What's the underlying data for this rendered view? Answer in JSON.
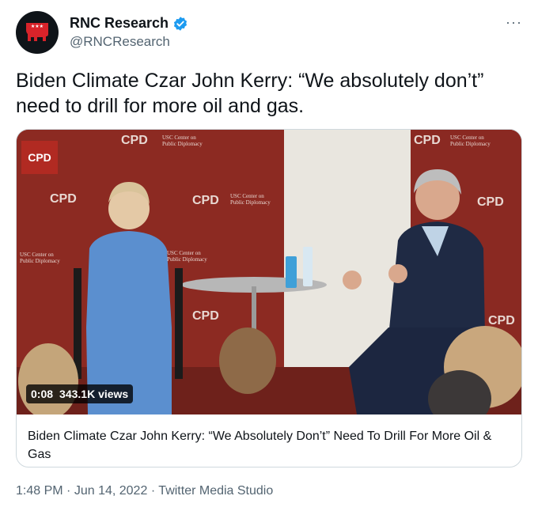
{
  "account": {
    "name": "RNC Research",
    "handle": "@RNCResearch",
    "more_icon": "more-horizontal-icon",
    "verified_icon": "verified-badge-icon"
  },
  "tweet": {
    "text": "Biden Climate Czar John Kerry: “We absolutely don’t” need to drill for more oil and gas."
  },
  "media": {
    "time": "0:08",
    "views": "343.1K views",
    "logo_text": "CPD",
    "backdrop_text": "CPD",
    "backdrop_sub1": "USC Center on",
    "backdrop_sub2": "Public Diplomacy",
    "card_title": "Biden Climate Czar John Kerry: “We Absolutely Don’t” Need To Drill For More Oil & Gas"
  },
  "footer": {
    "time": "1:48 PM",
    "date": "Jun 14, 2022",
    "source": "Twitter Media Studio",
    "sep": "·"
  },
  "colors": {
    "backdrop_red": "#8c2a22",
    "accent_blue": "#1d9bf0",
    "text_secondary": "#536471"
  }
}
